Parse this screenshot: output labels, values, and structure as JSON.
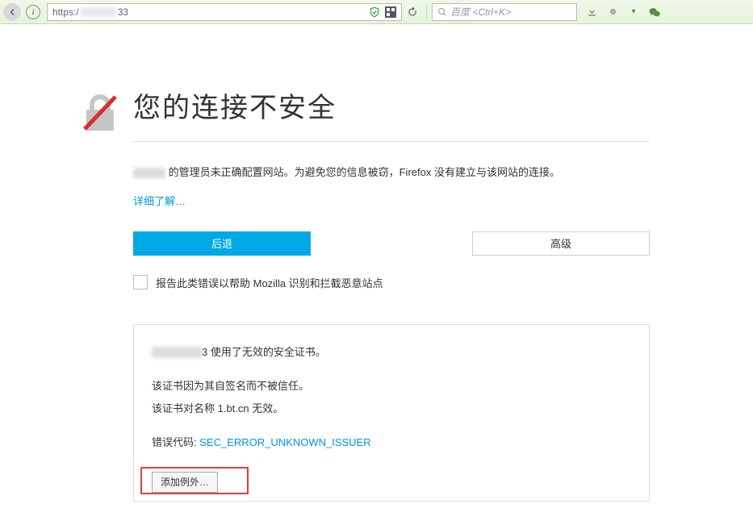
{
  "toolbar": {
    "url_prefix": "https:/",
    "url_suffix": "33",
    "search_placeholder": "百度 <Ctrl+K>"
  },
  "error": {
    "title": "您的连接不安全",
    "desc_suffix": " 的管理员未正确配置网站。为避免您的信息被窃，Firefox 没有建立与该网站的连接。",
    "learn_more": "详细了解…",
    "go_back": "后退",
    "advanced": "高级",
    "report_label": "报告此类错误以帮助 Mozilla 识别和拦截恶意站点"
  },
  "details": {
    "line1_suffix": "3 使用了无效的安全证书。",
    "line2": "该证书因为其自签名而不被信任。",
    "line3": "该证书对名称 1.bt.cn 无效。",
    "error_code_label": "错误代码: ",
    "error_code": "SEC_ERROR_UNKNOWN_ISSUER",
    "add_exception": "添加例外…"
  }
}
